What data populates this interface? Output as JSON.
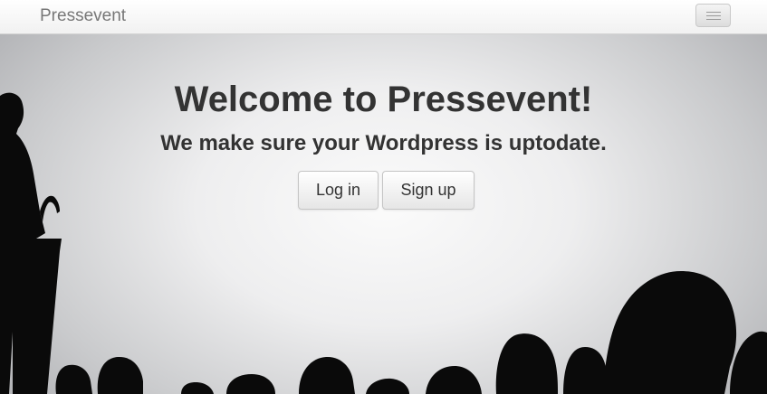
{
  "navbar": {
    "brand": "Pressevent",
    "menu_icon": "hamburger-menu-icon"
  },
  "hero": {
    "title": "Welcome to Pressevent!",
    "subtitle": "We make sure your Wordpress is uptodate.",
    "login_label": "Log in",
    "signup_label": "Sign up",
    "background_image": "audience-and-speaker-silhouette"
  },
  "colors": {
    "text": "#333333",
    "brand_text": "#777777",
    "silhouette": "#0a0a0a",
    "navbar_bg": "#f7f7f7"
  }
}
